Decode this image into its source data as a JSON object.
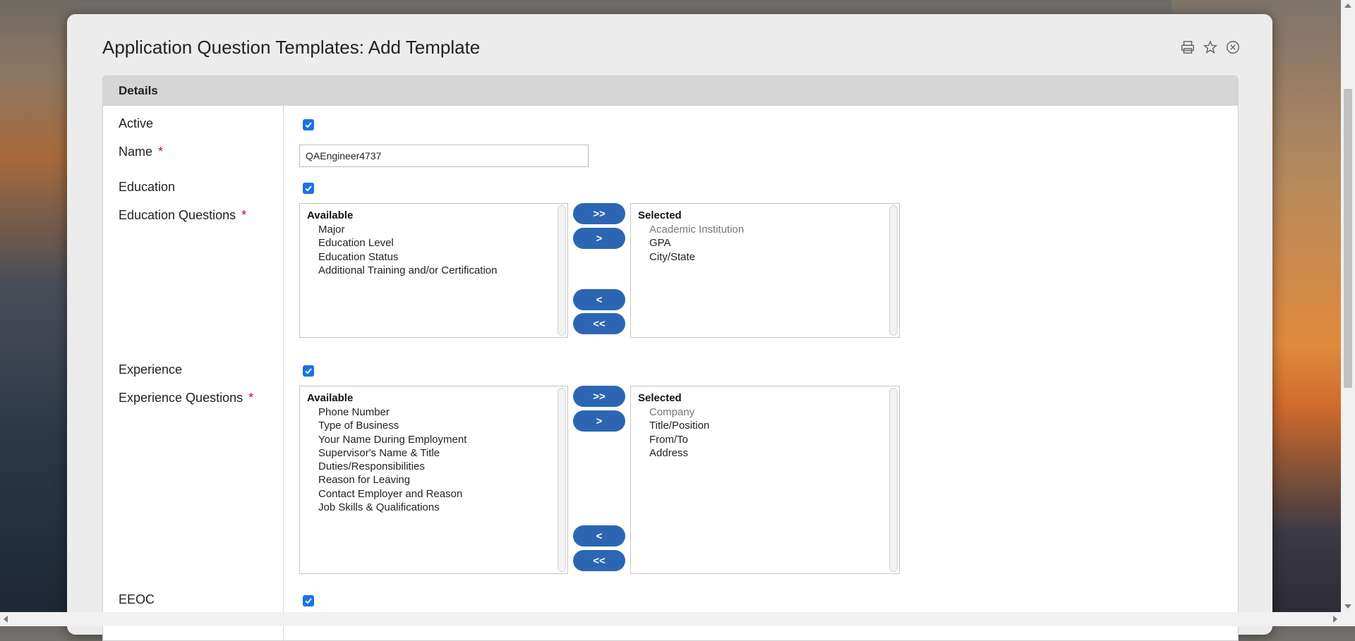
{
  "window": {
    "title": "Application Question Templates: Add Template",
    "icons": [
      "print-icon",
      "star-icon",
      "close-icon"
    ]
  },
  "panel": {
    "header": "Details"
  },
  "fields": {
    "active": {
      "label": "Active",
      "checked": true
    },
    "name": {
      "label": "Name",
      "required_mark": "*",
      "value": "QAEngineer4737"
    },
    "education": {
      "label": "Education",
      "checked": true
    },
    "education_questions": {
      "label": "Education Questions",
      "required_mark": "*",
      "available_title": "Available",
      "available": [
        "Major",
        "Education Level",
        "Education Status",
        "Additional Training and/or Certification"
      ],
      "selected_title": "Selected",
      "selected": [
        "Academic Institution",
        "GPA",
        "City/State"
      ]
    },
    "experience": {
      "label": "Experience",
      "checked": true
    },
    "experience_questions": {
      "label": "Experience Questions",
      "required_mark": "*",
      "available_title": "Available",
      "available": [
        "Phone Number",
        "Type of Business",
        "Your Name During Employment",
        "Supervisor's Name & Title",
        "Duties/Responsibilities",
        "Reason for Leaving",
        "Contact Employer and Reason",
        "Job Skills & Qualifications"
      ],
      "selected_title": "Selected",
      "selected": [
        "Company",
        "Title/Position",
        "From/To",
        "Address"
      ]
    },
    "eeoc": {
      "label": "EEOC",
      "checked": true
    }
  },
  "buttons": {
    "add_all": ">>",
    "add_one": ">",
    "remove_one": "<",
    "remove_all": "<<"
  },
  "colors": {
    "accent": "#2c66b2",
    "checkbox": "#1a73e8",
    "required": "#d0021b"
  }
}
